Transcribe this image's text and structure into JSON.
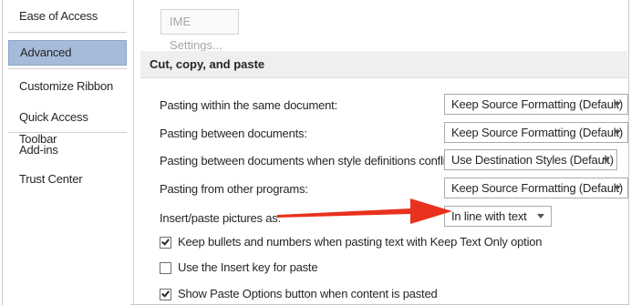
{
  "nav": {
    "items": [
      {
        "label": "Ease of Access"
      },
      {
        "label": "Advanced"
      },
      {
        "label": "Customize Ribbon"
      },
      {
        "label": "Quick Access Toolbar"
      },
      {
        "label": "Add-ins"
      },
      {
        "label": "Trust Center"
      }
    ],
    "selected": "Advanced"
  },
  "ime_button": {
    "label": "IME Settings..."
  },
  "section": {
    "title": "Cut, copy, and paste"
  },
  "options": [
    {
      "label": "Pasting within the same document:",
      "value": "Keep Source Formatting (Default)"
    },
    {
      "label": "Pasting between documents:",
      "value": "Keep Source Formatting (Default)"
    },
    {
      "label": "Pasting between documents when style definitions conflict:",
      "value": "Use Destination Styles (Default)"
    },
    {
      "label": "Pasting from other programs:",
      "value": "Keep Source Formatting (Default)"
    },
    {
      "label": "Insert/paste pictures as:",
      "value": "In line with text"
    }
  ],
  "checkboxes": [
    {
      "label": "Keep bullets and numbers when pasting text with Keep Text Only option",
      "checked": true
    },
    {
      "label": "Use the Insert key for paste",
      "checked": false
    },
    {
      "label": "Show Paste Options button when content is pasted",
      "checked": true
    }
  ],
  "annotation": {
    "arrow_color": "#e8321e"
  }
}
